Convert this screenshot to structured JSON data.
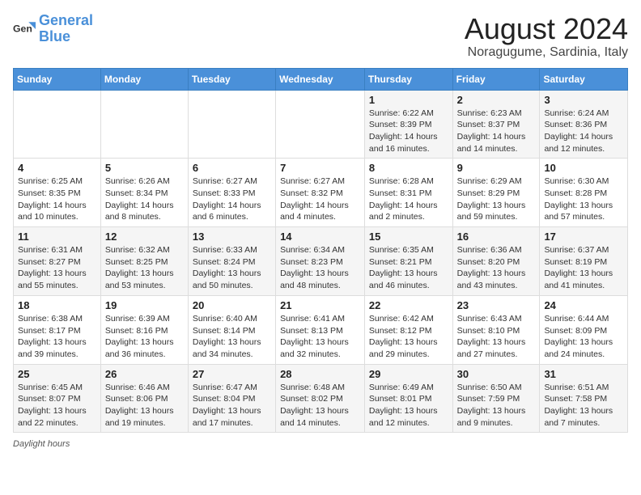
{
  "logo": {
    "line1": "General",
    "line2": "Blue"
  },
  "title": "August 2024",
  "subtitle": "Noragugume, Sardinia, Italy",
  "days_of_week": [
    "Sunday",
    "Monday",
    "Tuesday",
    "Wednesday",
    "Thursday",
    "Friday",
    "Saturday"
  ],
  "weeks": [
    [
      {
        "num": "",
        "info": ""
      },
      {
        "num": "",
        "info": ""
      },
      {
        "num": "",
        "info": ""
      },
      {
        "num": "",
        "info": ""
      },
      {
        "num": "1",
        "info": "Sunrise: 6:22 AM\nSunset: 8:39 PM\nDaylight: 14 hours and 16 minutes."
      },
      {
        "num": "2",
        "info": "Sunrise: 6:23 AM\nSunset: 8:37 PM\nDaylight: 14 hours and 14 minutes."
      },
      {
        "num": "3",
        "info": "Sunrise: 6:24 AM\nSunset: 8:36 PM\nDaylight: 14 hours and 12 minutes."
      }
    ],
    [
      {
        "num": "4",
        "info": "Sunrise: 6:25 AM\nSunset: 8:35 PM\nDaylight: 14 hours and 10 minutes."
      },
      {
        "num": "5",
        "info": "Sunrise: 6:26 AM\nSunset: 8:34 PM\nDaylight: 14 hours and 8 minutes."
      },
      {
        "num": "6",
        "info": "Sunrise: 6:27 AM\nSunset: 8:33 PM\nDaylight: 14 hours and 6 minutes."
      },
      {
        "num": "7",
        "info": "Sunrise: 6:27 AM\nSunset: 8:32 PM\nDaylight: 14 hours and 4 minutes."
      },
      {
        "num": "8",
        "info": "Sunrise: 6:28 AM\nSunset: 8:31 PM\nDaylight: 14 hours and 2 minutes."
      },
      {
        "num": "9",
        "info": "Sunrise: 6:29 AM\nSunset: 8:29 PM\nDaylight: 13 hours and 59 minutes."
      },
      {
        "num": "10",
        "info": "Sunrise: 6:30 AM\nSunset: 8:28 PM\nDaylight: 13 hours and 57 minutes."
      }
    ],
    [
      {
        "num": "11",
        "info": "Sunrise: 6:31 AM\nSunset: 8:27 PM\nDaylight: 13 hours and 55 minutes."
      },
      {
        "num": "12",
        "info": "Sunrise: 6:32 AM\nSunset: 8:25 PM\nDaylight: 13 hours and 53 minutes."
      },
      {
        "num": "13",
        "info": "Sunrise: 6:33 AM\nSunset: 8:24 PM\nDaylight: 13 hours and 50 minutes."
      },
      {
        "num": "14",
        "info": "Sunrise: 6:34 AM\nSunset: 8:23 PM\nDaylight: 13 hours and 48 minutes."
      },
      {
        "num": "15",
        "info": "Sunrise: 6:35 AM\nSunset: 8:21 PM\nDaylight: 13 hours and 46 minutes."
      },
      {
        "num": "16",
        "info": "Sunrise: 6:36 AM\nSunset: 8:20 PM\nDaylight: 13 hours and 43 minutes."
      },
      {
        "num": "17",
        "info": "Sunrise: 6:37 AM\nSunset: 8:19 PM\nDaylight: 13 hours and 41 minutes."
      }
    ],
    [
      {
        "num": "18",
        "info": "Sunrise: 6:38 AM\nSunset: 8:17 PM\nDaylight: 13 hours and 39 minutes."
      },
      {
        "num": "19",
        "info": "Sunrise: 6:39 AM\nSunset: 8:16 PM\nDaylight: 13 hours and 36 minutes."
      },
      {
        "num": "20",
        "info": "Sunrise: 6:40 AM\nSunset: 8:14 PM\nDaylight: 13 hours and 34 minutes."
      },
      {
        "num": "21",
        "info": "Sunrise: 6:41 AM\nSunset: 8:13 PM\nDaylight: 13 hours and 32 minutes."
      },
      {
        "num": "22",
        "info": "Sunrise: 6:42 AM\nSunset: 8:12 PM\nDaylight: 13 hours and 29 minutes."
      },
      {
        "num": "23",
        "info": "Sunrise: 6:43 AM\nSunset: 8:10 PM\nDaylight: 13 hours and 27 minutes."
      },
      {
        "num": "24",
        "info": "Sunrise: 6:44 AM\nSunset: 8:09 PM\nDaylight: 13 hours and 24 minutes."
      }
    ],
    [
      {
        "num": "25",
        "info": "Sunrise: 6:45 AM\nSunset: 8:07 PM\nDaylight: 13 hours and 22 minutes."
      },
      {
        "num": "26",
        "info": "Sunrise: 6:46 AM\nSunset: 8:06 PM\nDaylight: 13 hours and 19 minutes."
      },
      {
        "num": "27",
        "info": "Sunrise: 6:47 AM\nSunset: 8:04 PM\nDaylight: 13 hours and 17 minutes."
      },
      {
        "num": "28",
        "info": "Sunrise: 6:48 AM\nSunset: 8:02 PM\nDaylight: 13 hours and 14 minutes."
      },
      {
        "num": "29",
        "info": "Sunrise: 6:49 AM\nSunset: 8:01 PM\nDaylight: 13 hours and 12 minutes."
      },
      {
        "num": "30",
        "info": "Sunrise: 6:50 AM\nSunset: 7:59 PM\nDaylight: 13 hours and 9 minutes."
      },
      {
        "num": "31",
        "info": "Sunrise: 6:51 AM\nSunset: 7:58 PM\nDaylight: 13 hours and 7 minutes."
      }
    ]
  ],
  "footer": {
    "label": "Daylight hours"
  }
}
